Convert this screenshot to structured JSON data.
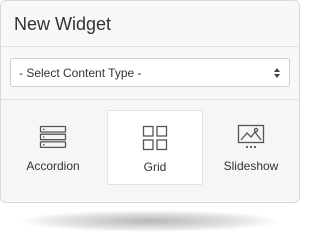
{
  "widget": {
    "title": "New Widget",
    "select": {
      "value": "- Select Content Type -"
    },
    "content_types": [
      {
        "label": "Accordion",
        "icon": "accordion-icon"
      },
      {
        "label": "Grid",
        "icon": "grid-icon",
        "selected": true
      },
      {
        "label": "Slideshow",
        "icon": "slideshow-icon"
      }
    ]
  },
  "colors": {
    "icon_stroke": "#555555",
    "border": "#d9d9d9",
    "panel_bg": "#f8f8f8"
  }
}
